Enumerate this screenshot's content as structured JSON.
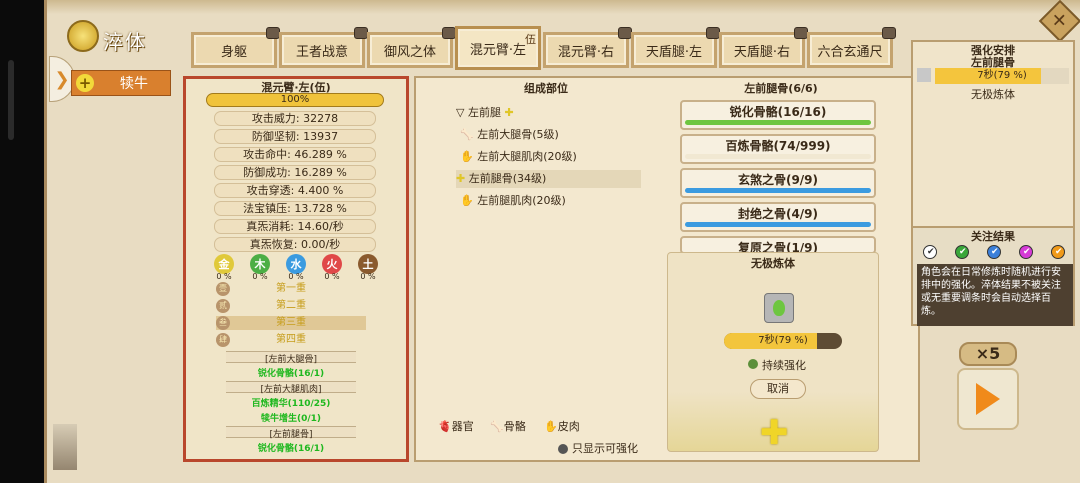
{
  "header": {
    "title": "淬体",
    "close_symbol": "✕"
  },
  "left_nav": {
    "category": "犊牛",
    "arrow": "❯",
    "plus": "+"
  },
  "tabs": [
    {
      "label": "身躯"
    },
    {
      "label": "王者战意"
    },
    {
      "label": "御风之体"
    },
    {
      "label": "混元臂·左",
      "num": "伍"
    },
    {
      "label": "混元臂·右"
    },
    {
      "label": "天盾腿·左"
    },
    {
      "label": "天盾腿·右"
    },
    {
      "label": "六合玄通尺"
    }
  ],
  "stats_panel": {
    "title": "混元臂·左(伍)",
    "progress": "100%",
    "stats": [
      "攻击威力: 32278",
      "防御坚韧: 13937",
      "攻击命中: 46.289 %",
      "防御成功: 16.289 %",
      "攻击穿透: 4.400 %",
      "法宝镇压: 13.728 %",
      "真炁消耗: 14.60/秒",
      "真炁恢复: 0.00/秒"
    ],
    "elements": [
      {
        "label": "金",
        "pct": "0 %",
        "color": "#e0c93a"
      },
      {
        "label": "木",
        "pct": "0 %",
        "color": "#4cae45"
      },
      {
        "label": "水",
        "pct": "0 %",
        "color": "#3b9be0"
      },
      {
        "label": "火",
        "pct": "0 %",
        "color": "#e04848"
      },
      {
        "label": "土",
        "pct": "0 %",
        "color": "#8a5a2e"
      }
    ],
    "layers": [
      {
        "mark": "壹",
        "label": "第一重"
      },
      {
        "mark": "贰",
        "label": "第二重"
      },
      {
        "mark": "叁",
        "label": "第三重"
      },
      {
        "mark": "肆",
        "label": "第四重"
      }
    ],
    "details": [
      {
        "kind": "bracket",
        "text": "[左前大腿骨]"
      },
      {
        "kind": "green",
        "text": "锐化骨骼(16/1)"
      },
      {
        "kind": "bracket",
        "text": "[左前大腿肌肉]"
      },
      {
        "kind": "green",
        "text": "百炼精华(110/25)"
      },
      {
        "kind": "green",
        "text": "犊牛增生(0/1)"
      },
      {
        "kind": "bracket",
        "text": "[左前腿骨]"
      },
      {
        "kind": "green",
        "text": "锐化骨骼(16/1)"
      }
    ]
  },
  "components": {
    "header": "组成部位",
    "tree": [
      {
        "icon": "▽",
        "label": "左前腿",
        "plus": "✚"
      },
      {
        "icon": "🦴",
        "label": "左前大腿骨(5级)"
      },
      {
        "icon": "✋",
        "label": "左前大腿肌肉(20级)"
      },
      {
        "icon": "✚",
        "label": "左前腿骨(34级)"
      },
      {
        "icon": "✋",
        "label": "左前腿肌肉(20级)"
      }
    ],
    "legend": [
      "器官",
      "骨骼",
      "皮肉"
    ],
    "legend_icons": [
      "🫀",
      "🦴",
      "✋"
    ],
    "filter": "只显示可强化"
  },
  "parts": {
    "header": "左前腿骨(6/6)",
    "buttons": [
      {
        "label": "锐化骨骼(16/16)",
        "color": "#6ec640"
      },
      {
        "label": "百炼骨骼(74/999)",
        "color": "#f1e8d2"
      },
      {
        "label": "玄煞之骨(9/9)",
        "color": "#3b9be0"
      },
      {
        "label": "封绝之骨(4/9)",
        "color": "#3b9be0"
      },
      {
        "label": "复原之骨(1/9)",
        "color": "#f0a040"
      }
    ]
  },
  "popup": {
    "title": "无极炼体",
    "timer": "7秒(79 %)",
    "timer_fraction": 0.79,
    "keep": "持续强化",
    "cancel": "取消",
    "plus": "✚"
  },
  "enhance": {
    "title": "强化安排",
    "target": "左前腿骨",
    "slot": "7秒(79 %)",
    "slot_fraction": 0.79,
    "desc": "无极炼体"
  },
  "focus": {
    "title": "关注结果",
    "dots": [
      "#ffffff",
      "#3aa63a",
      "#3b7fd9",
      "#d63ad6",
      "#f09a1a"
    ],
    "check": "✔",
    "note": "角色会在日常修炼时随机进行安排中的强化。淬体结果不被关注或无重要调条时会自动选择百炼。"
  },
  "speed": "×5",
  "play": "play"
}
